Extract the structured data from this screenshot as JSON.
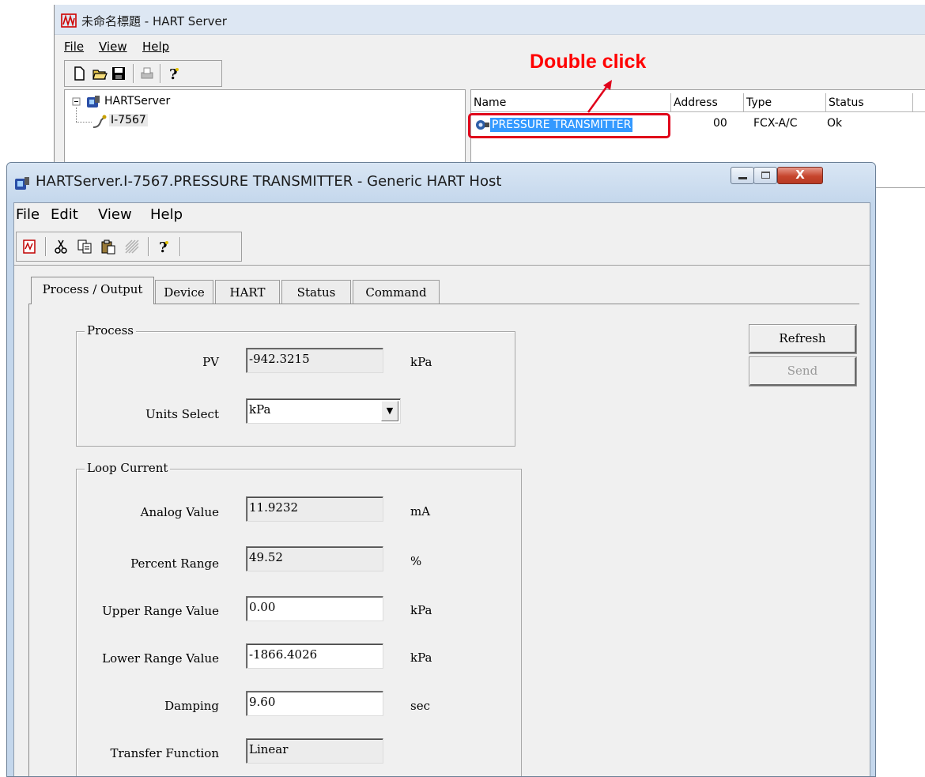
{
  "background_window": {
    "title": "未命名標題 - HART Server",
    "menu": [
      "File",
      "View",
      "Help"
    ],
    "toolbar_icons": [
      "new-file-icon",
      "open-folder-icon",
      "save-icon",
      "print-icon",
      "help-icon"
    ],
    "tree": {
      "root": "HARTServer",
      "child": "I-7567"
    },
    "list": {
      "columns": [
        "Name",
        "Address",
        "Type",
        "Status"
      ],
      "row": {
        "name": "PRESSURE TRANSMITTER",
        "address": "00",
        "type": "FCX-A/C",
        "status": "Ok"
      }
    }
  },
  "annotation": {
    "text": "Double click",
    "color": "#ff0000"
  },
  "dialog": {
    "title": "HARTServer.I-7567.PRESSURE TRANSMITTER - Generic HART Host",
    "menu": [
      "File",
      "Edit",
      "View",
      "Help"
    ],
    "toolbar_icons": [
      "hart-doc-icon",
      "cut-icon",
      "copy-icon",
      "paste-icon",
      "disabled-icon",
      "help-icon"
    ],
    "tabs": [
      "Process / Output",
      "Device",
      "HART",
      "Status",
      "Command"
    ],
    "active_tab": "Process / Output",
    "process": {
      "title": "Process",
      "pv_label": "PV",
      "pv_value": "-942.3215",
      "pv_unit": "kPa",
      "units_label": "Units Select",
      "units_value": "kPa"
    },
    "loop": {
      "title": "Loop Current",
      "rows": [
        {
          "label": "Analog Value",
          "value": "11.9232",
          "unit": "mA",
          "editable": false
        },
        {
          "label": "Percent Range",
          "value": "49.52",
          "unit": "%",
          "editable": false
        },
        {
          "label": "Upper Range Value",
          "value": "0.00",
          "unit": "kPa",
          "editable": true
        },
        {
          "label": "Lower Range Value",
          "value": "-1866.4026",
          "unit": "kPa",
          "editable": true
        },
        {
          "label": "Damping",
          "value": "9.60",
          "unit": "sec",
          "editable": true
        },
        {
          "label": "Transfer Function",
          "value": "Linear",
          "unit": "",
          "editable": false
        }
      ]
    },
    "buttons": {
      "refresh": "Refresh",
      "send": "Send"
    },
    "caption_buttons": {
      "close": "X"
    }
  }
}
